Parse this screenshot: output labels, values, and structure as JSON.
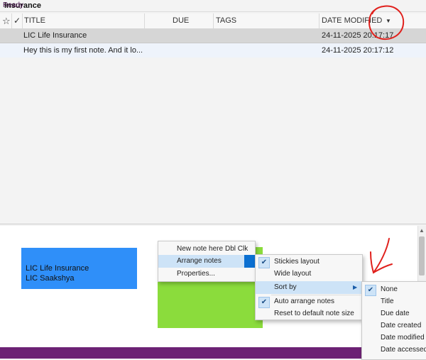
{
  "title": "Insurance",
  "table": {
    "header": {
      "star_icon": "☆",
      "check_icon": "✓",
      "title": "TITLE",
      "due": "DUE",
      "tags": "TAGS",
      "date_modified": "DATE MODIFIED",
      "sort_icon": "▼"
    },
    "rows": [
      {
        "title": "LIC Life Insurance",
        "date": "24-11-2025 20:17:17"
      },
      {
        "title": "Hey this is my first note. And it lo...",
        "date": "24-11-2025 20:17:12"
      }
    ]
  },
  "notes": {
    "blue": {
      "line1": "LIC Life Insurance",
      "line2": "LIC Saakshya",
      "color": "#2f8ff9"
    },
    "green": {
      "color": "#8bdc3c"
    }
  },
  "status": "Ready",
  "menu": {
    "new_note": "New note here",
    "new_note_shortcut": "Dbl Clk",
    "arrange": "Arrange notes",
    "properties": "Properties..."
  },
  "arrange_menu": {
    "stickies": "Stickies layout",
    "wide": "Wide layout",
    "sort_by": "Sort by",
    "auto_arrange": "Auto arrange notes",
    "reset": "Reset to default note size"
  },
  "sort_menu": {
    "none": "None",
    "title": "Title",
    "due_date": "Due date",
    "date_created": "Date created",
    "date_modified": "Date modified",
    "date_accessed": "Date accessed"
  },
  "colors": {
    "accent": "#cde3f7",
    "status_bar": "#6c2274",
    "annotation": "#e0201c"
  }
}
